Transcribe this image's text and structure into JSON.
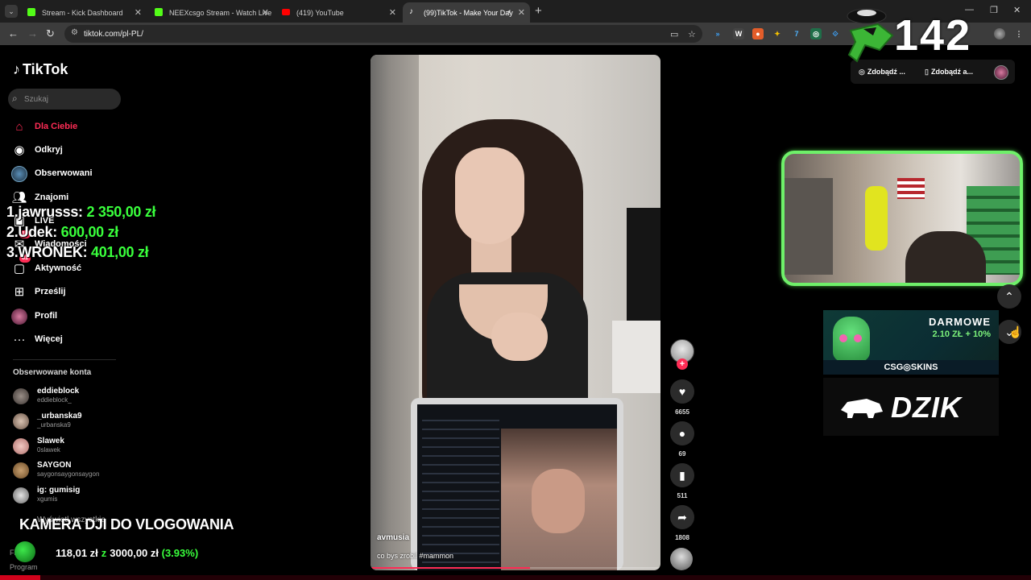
{
  "browser": {
    "tabs": [
      {
        "title": "Stream - Kick Dashboard",
        "icon": "kick-icon",
        "color": "#53fc18"
      },
      {
        "title": "NEEXcsgo Stream - Watch Live",
        "icon": "kick-icon",
        "color": "#53fc18"
      },
      {
        "title": "(419) YouTube",
        "icon": "youtube-icon",
        "color": "#ff0000"
      },
      {
        "title": "(99)TikTok - Make Your Day",
        "icon": "tiktok-icon",
        "color": "#ffffff"
      }
    ],
    "url": "tiktok.com/pl-PL/"
  },
  "tiktok": {
    "logo": "TikTok",
    "search_placeholder": "Szukaj",
    "nav": [
      {
        "label": "Dla Ciebie",
        "icon": "home-icon",
        "active": true
      },
      {
        "label": "Odkryj",
        "icon": "compass-icon"
      },
      {
        "label": "Obserwowani",
        "icon": "following-avatar-icon"
      },
      {
        "label": "Znajomi",
        "icon": "friends-icon"
      },
      {
        "label": "LIVE",
        "icon": "live-icon"
      },
      {
        "label": "Wiadomości",
        "icon": "messages-icon",
        "badge": "18"
      },
      {
        "label": "Aktywność",
        "icon": "activity-icon",
        "badge": "81"
      },
      {
        "label": "Prześlij",
        "icon": "upload-icon"
      },
      {
        "label": "Profil",
        "icon": "profile-avatar-icon"
      },
      {
        "label": "Więcej",
        "icon": "more-icon"
      }
    ],
    "followed_title": "Obserwowane konta",
    "followed": [
      {
        "name": "eddieblock",
        "handle": "eddieblock_"
      },
      {
        "name": "_urbanska9",
        "handle": "_urbanska9"
      },
      {
        "name": "Slawek",
        "handle": "0slawek"
      },
      {
        "name": "SAYGON",
        "handle": "saygonsaygonsaygon"
      },
      {
        "name": "ig: gumisig",
        "handle": "xgumis"
      }
    ],
    "see_all": "Wyświetl wszystkie",
    "footer": [
      "Firma",
      "Program"
    ]
  },
  "overlay": {
    "leaderboard": [
      {
        "rank_name": "1.jawrusss:",
        "amount": "2 350,00 zł"
      },
      {
        "rank_name": "2.Udek:",
        "amount": "600,00 zł"
      },
      {
        "rank_name": "3.WRONEK:",
        "amount": "401,00 zł"
      }
    ],
    "goal_title": "KAMERA DJI DO VLOGOWANIA",
    "goal_current": "118,01 zł",
    "goal_separator": "z",
    "goal_target": "3000,00 zł",
    "goal_percent": "(3.93%)",
    "goal_progress": 0.0393,
    "counter": "142"
  },
  "video": {
    "username": "avmusia",
    "caption": "co bys zrobil #mammon",
    "playback_progress": 0.55,
    "actions": {
      "likes": "6655",
      "comments": "69",
      "saves": "511",
      "shares": "1808"
    }
  },
  "right": {
    "get_buttons": [
      "Zdobądź ...",
      "Zdobądź a..."
    ],
    "promo_title": "DARMOWE",
    "promo_amount": "2.10 ZŁ + 10%",
    "promo_brand": "CSG◎SKINS",
    "dzik": "DZIK"
  },
  "colors": {
    "accent_tiktok": "#fe2c55",
    "overlay_green": "#39ff3c",
    "webcam_border": "#6ff06a"
  }
}
